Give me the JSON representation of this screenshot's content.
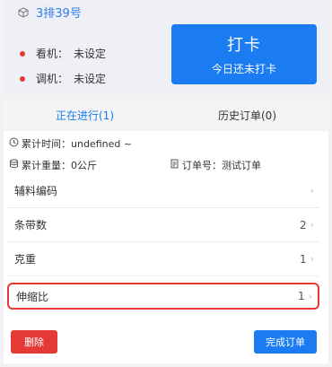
{
  "header": {
    "machine_title": "3排39号",
    "status_rows": [
      {
        "label": "看机",
        "value": "未设定"
      },
      {
        "label": "调机",
        "value": "未设定"
      }
    ],
    "checkin": {
      "main": "打卡",
      "sub": "今日还未打卡"
    }
  },
  "tabs": [
    {
      "label": "正在进行(1)",
      "active": true
    },
    {
      "label": "历史订单(0)",
      "active": false
    }
  ],
  "order": {
    "time_label": "累计时间：",
    "time_value": "undefined ~",
    "weight_label": "累计重量：",
    "weight_value": "0公斤",
    "order_no_label": "订单号：",
    "order_no_value": "测试订单"
  },
  "fields": [
    {
      "label": "辅料编码",
      "value": ""
    },
    {
      "label": "条带数",
      "value": "2"
    },
    {
      "label": "克重",
      "value": "1"
    },
    {
      "label": "伸缩比",
      "value": "1"
    }
  ],
  "chevron": "›",
  "actions": {
    "delete": "删除",
    "finish": "完成订单"
  },
  "colors": {
    "accent": "#1a7cf0",
    "danger": "#e53935"
  }
}
